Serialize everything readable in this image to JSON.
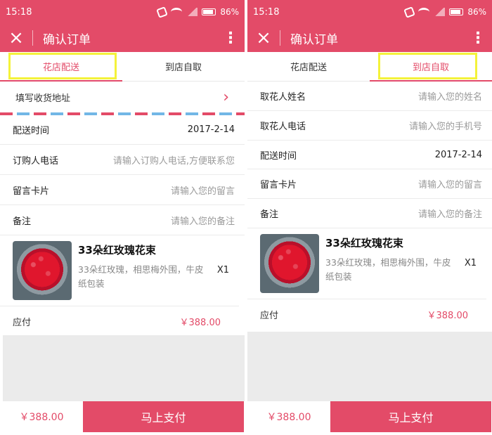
{
  "status": {
    "time": "15:18",
    "battery": "86%"
  },
  "appbar": {
    "title": "确认订单",
    "close_icon": "×",
    "more_icon": "⋮"
  },
  "tabs": [
    "花店配送",
    "到店自取"
  ],
  "left": {
    "address_label": "填写收货地址",
    "rows": [
      {
        "label": "配送时间",
        "value": "2017-2-14"
      },
      {
        "label": "订购人电话",
        "placeholder": "请输入订购人电话,方便联系您"
      },
      {
        "label": "留言卡片",
        "placeholder": "请输入您的留言"
      },
      {
        "label": "备注",
        "placeholder": "请输入您的备注"
      }
    ]
  },
  "right": {
    "rows": [
      {
        "label": "取花人姓名",
        "placeholder": "请输入您的姓名"
      },
      {
        "label": "取花人电话",
        "placeholder": "请输入您的手机号"
      },
      {
        "label": "配送时间",
        "value": "2017-2-14"
      },
      {
        "label": "留言卡片",
        "placeholder": "请输入您的留言"
      },
      {
        "label": "备注",
        "placeholder": "请输入您的备注"
      }
    ]
  },
  "product": {
    "name": "33朵红玫瑰花束",
    "desc": "33朵红玫瑰，相思梅外围，牛皮纸包装",
    "qty": "X1"
  },
  "payment": {
    "label": "应付",
    "amount": "￥388.00"
  },
  "footer": {
    "total": "￥388.00",
    "pay_button": "马上支付"
  }
}
